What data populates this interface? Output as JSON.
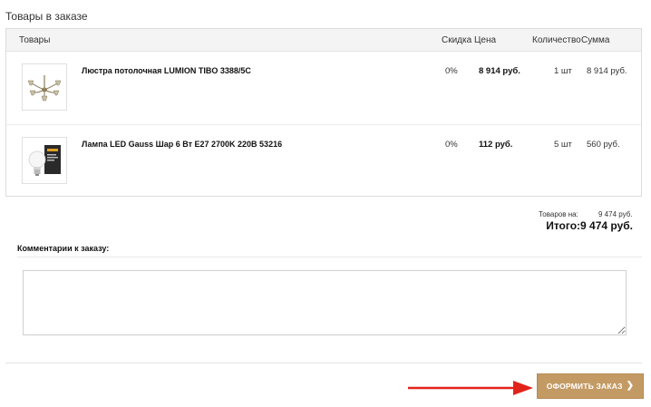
{
  "order": {
    "section_title": "Товары в заказе",
    "columns": {
      "goods": "Товары",
      "discount": "Скидка",
      "price": "Цена",
      "quantity": "Количество",
      "sum": "Сумма"
    },
    "items": [
      {
        "name": "Люстра потолочная LUMION TIBO 3388/5C",
        "discount": "0%",
        "price": "8 914 руб.",
        "quantity": "1 шт",
        "sum": "8 914 руб.",
        "image_icon": "chandelier-thumbnail"
      },
      {
        "name": "Лампа LED Gauss Шар 6 Вт E27 2700K 220В 53216",
        "discount": "0%",
        "price": "112 руб.",
        "quantity": "5 шт",
        "sum": "560 руб.",
        "image_icon": "led-bulb-thumbnail"
      }
    ]
  },
  "totals": {
    "goods_label": "Товаров на:",
    "goods_value": "9 474 руб.",
    "grand_total": "Итого:9 474 руб."
  },
  "comments": {
    "label": "Комментарии к заказу:",
    "value": "",
    "placeholder": ""
  },
  "actions": {
    "submit_label": "ОФОРМИТЬ ЗАКАЗ",
    "submit_icon": "chevron-right-icon"
  },
  "colors": {
    "accent": "#c49a64",
    "annotation_arrow": "#e2231a"
  }
}
